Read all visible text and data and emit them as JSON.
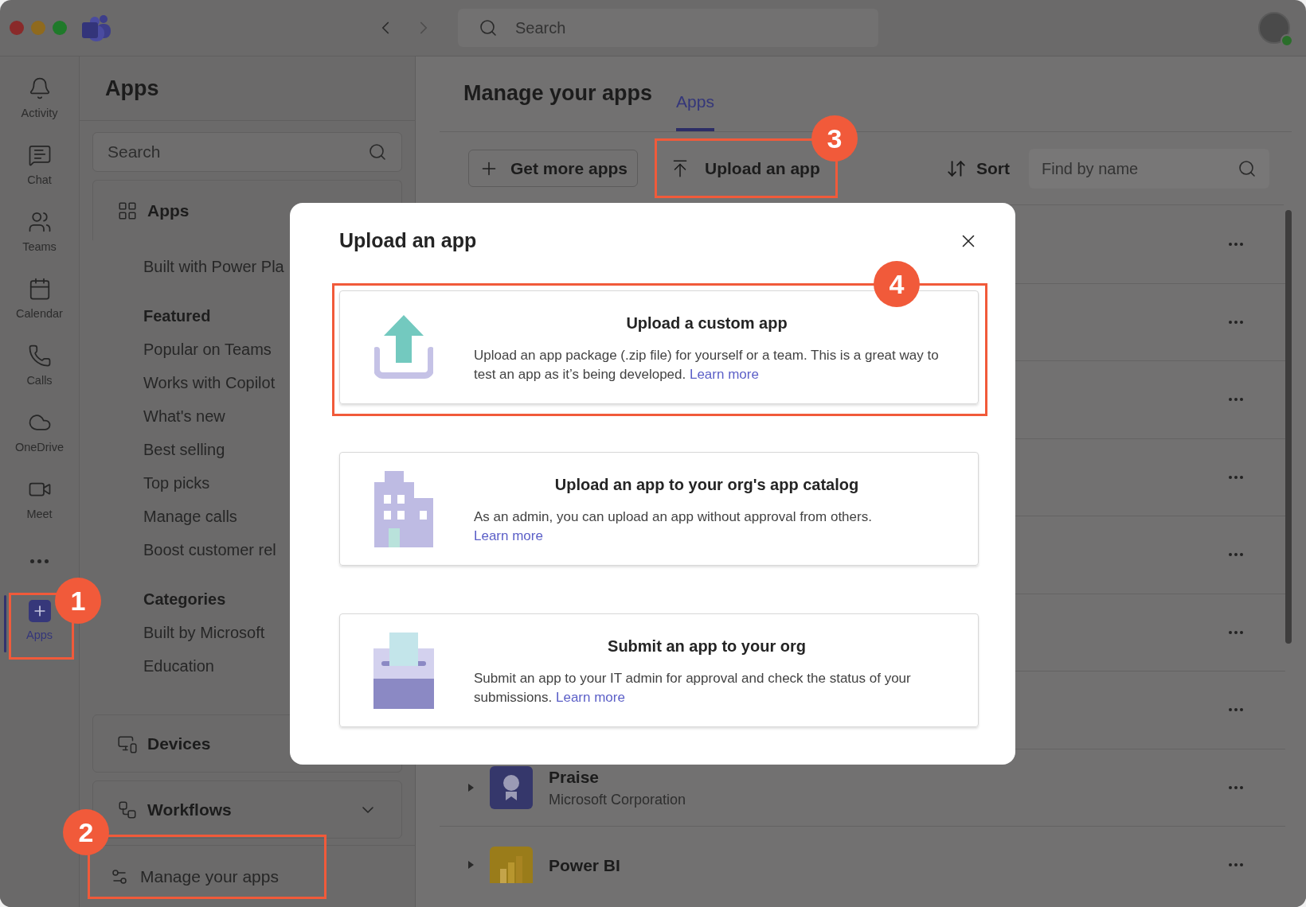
{
  "top_bar": {
    "search_placeholder": "Search"
  },
  "rail": [
    {
      "kind": "item",
      "label": "Activity",
      "selected": false
    },
    {
      "kind": "item",
      "label": "Chat",
      "selected": false
    },
    {
      "kind": "item",
      "label": "Teams",
      "selected": false
    },
    {
      "kind": "item",
      "label": "Calendar",
      "selected": false
    },
    {
      "kind": "item",
      "label": "Calls",
      "selected": false
    },
    {
      "kind": "item",
      "label": "OneDrive",
      "selected": false
    },
    {
      "kind": "item",
      "label": "Meet",
      "selected": false
    },
    {
      "kind": "more",
      "selected": false
    },
    {
      "kind": "item",
      "label": "Apps",
      "selected": true
    }
  ],
  "sidebar": {
    "title": "Apps",
    "search_placeholder": "Search",
    "section": "Apps",
    "items": [
      {
        "kind": "link",
        "label": "Built with Power Pla"
      },
      {
        "kind": "heading",
        "label": "Featured"
      },
      {
        "kind": "link",
        "label": "Popular on Teams"
      },
      {
        "kind": "link",
        "label": "Works with Copilot"
      },
      {
        "kind": "link",
        "label": "What's new"
      },
      {
        "kind": "link",
        "label": "Best selling"
      },
      {
        "kind": "link",
        "label": "Top picks"
      },
      {
        "kind": "link",
        "label": "Manage calls"
      },
      {
        "kind": "link",
        "label": "Boost customer rel"
      },
      {
        "kind": "heading",
        "label": "Categories"
      },
      {
        "kind": "link",
        "label": "Built by Microsoft"
      },
      {
        "kind": "link",
        "label": "Education"
      }
    ],
    "devices": "Devices",
    "workflows": "Workflows",
    "manage": "Manage your apps"
  },
  "main": {
    "title": "Manage your apps",
    "tabs": [
      {
        "label": "Apps",
        "selected": true
      }
    ],
    "get_more": "Get more apps",
    "upload": "Upload an app",
    "sort": "Sort",
    "find_placeholder": "Find by name",
    "rows": [
      {
        "kind": "covered"
      },
      {
        "kind": "covered"
      },
      {
        "kind": "covered"
      },
      {
        "kind": "covered"
      },
      {
        "kind": "covered"
      },
      {
        "kind": "covered"
      },
      {
        "kind": "covered"
      },
      {
        "kind": "app",
        "name": "Praise",
        "publisher": "Microsoft Corporation"
      },
      {
        "kind": "app",
        "name": "Power BI"
      }
    ]
  },
  "dialog": {
    "title": "Upload an app",
    "options": [
      {
        "title": "Upload a custom app",
        "text": "Upload an app package (.zip file) for yourself or a team. This is a great way to test an app as it’s being developed.",
        "link": "Learn more"
      },
      {
        "title": "Upload an app to your org's app catalog",
        "text": "As an admin, you can upload an app without approval from others.",
        "link": "Learn more"
      },
      {
        "title": "Submit an app to your org",
        "text": "Submit an app to your IT admin for approval and check the status of your submissions.",
        "link": "Learn more"
      }
    ]
  },
  "callouts": [
    {
      "label": "1"
    },
    {
      "label": "2"
    },
    {
      "label": "3"
    },
    {
      "label": "4"
    }
  ]
}
